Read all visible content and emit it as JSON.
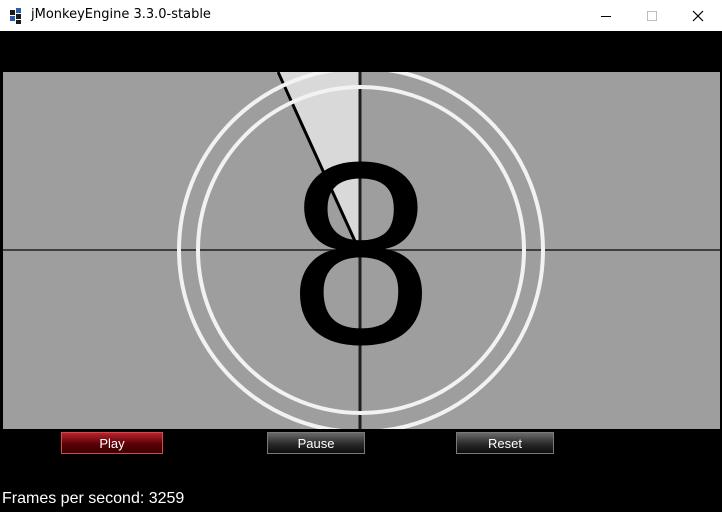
{
  "window": {
    "title": "jMonkeyEngine 3.3.0-stable",
    "controls": [
      "minimize",
      "maximize",
      "close"
    ]
  },
  "countdown": {
    "digit": "8",
    "background_color": "#9e9e9e",
    "sweep_color": "#d9d9d9",
    "ring_color": "#f2f2f2"
  },
  "controls": {
    "play_label": "Play",
    "pause_label": "Pause",
    "reset_label": "Reset"
  },
  "hud": {
    "fps_text": "Frames per second: 3259"
  },
  "icons": [
    "jmonkey-app-icon",
    "minimize-icon",
    "maximize-icon",
    "close-icon"
  ]
}
